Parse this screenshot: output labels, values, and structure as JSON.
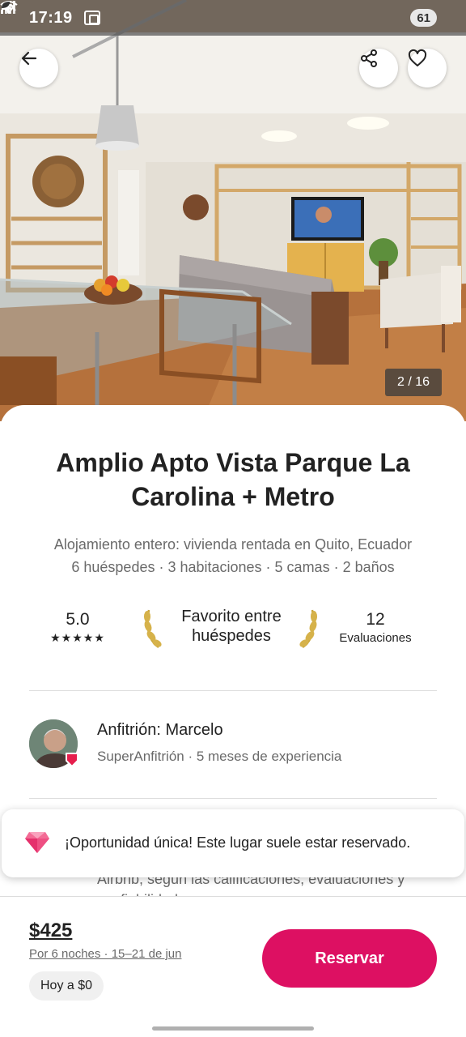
{
  "status_bar": {
    "time": "17:19",
    "battery": "61"
  },
  "gallery": {
    "counter": "2 / 16"
  },
  "listing": {
    "title": "Amplio Apto Vista Parque La Carolina + Metro",
    "type_location": "Alojamiento entero: vivienda rentada en Quito, Ecuador",
    "details": "6 huéspedes · 3 habitaciones · 5 camas · 2 baños"
  },
  "stats": {
    "rating": "5.0",
    "stars": "★★★★★",
    "favorite_label": "Favorito entre huéspedes",
    "reviews_count": "12",
    "reviews_label": "Evaluaciones"
  },
  "host": {
    "name": "Anfitrión: Marcelo",
    "subtitle": "SuperAnfitrión · 5 meses de experiencia"
  },
  "partially_hidden_text": "Airbnb, según las calificaciones, evaluaciones y confiabilidad",
  "toast": {
    "message": "¡Oportunidad única! Este lugar suele estar reservado."
  },
  "footer": {
    "price": "$425",
    "price_detail": "Por 6 noches · 15–21 de jun",
    "pay_today": "Hoy a $0",
    "reserve_label": "Reservar"
  },
  "colors": {
    "brand": "#dd1062",
    "text_primary": "#222222",
    "text_secondary": "#6a6a6a"
  },
  "icons": {
    "back": "arrow-left-icon",
    "share": "share-icon",
    "favorite": "heart-icon",
    "laurel": "laurel-icon",
    "gem": "gem-icon"
  }
}
